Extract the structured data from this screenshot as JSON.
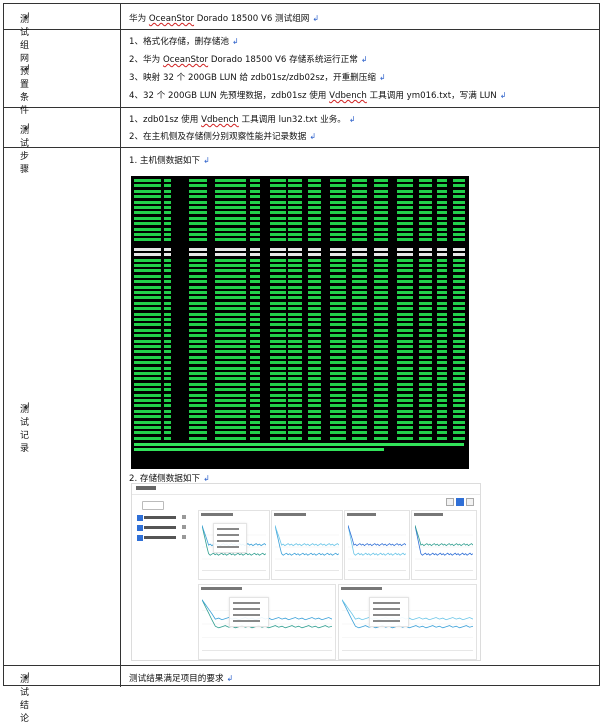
{
  "rows": [
    {
      "label": "测试组网",
      "content": "华为 OceanStor Dorado 18500 V6 测试组网"
    },
    {
      "label": "预置条件",
      "items": [
        "1、格式化存储，删存储池",
        "2、华为 OceanStor Dorado 18500 V6 存储系统运行正常",
        "3、映射 32 个 200GB LUN 给 zdb01sz/zdb02sz，开重删压缩",
        "4、32 个 200GB LUN 先预埋数据，zdb01sz 使用 Vdbench 工具调用 ym016.txt，写满 LUN"
      ]
    },
    {
      "label": "测试步骤",
      "items": [
        "1、zdb01sz 使用 Vdbench 工具调用 lun32.txt 业务。",
        "2、在主机侧及存储侧分别观察性能并记录数据"
      ]
    },
    {
      "label": "测试记录",
      "items": [
        "1.    主机侧数据如下",
        "2.    存储侧数据如下"
      ]
    },
    {
      "label": "测试结论",
      "content": "测试结果满足项目的要求"
    }
  ],
  "colors": {
    "terminal_bg": "#000000",
    "terminal_text": "#22d04a",
    "selection_blue": "#2f6fd6"
  }
}
